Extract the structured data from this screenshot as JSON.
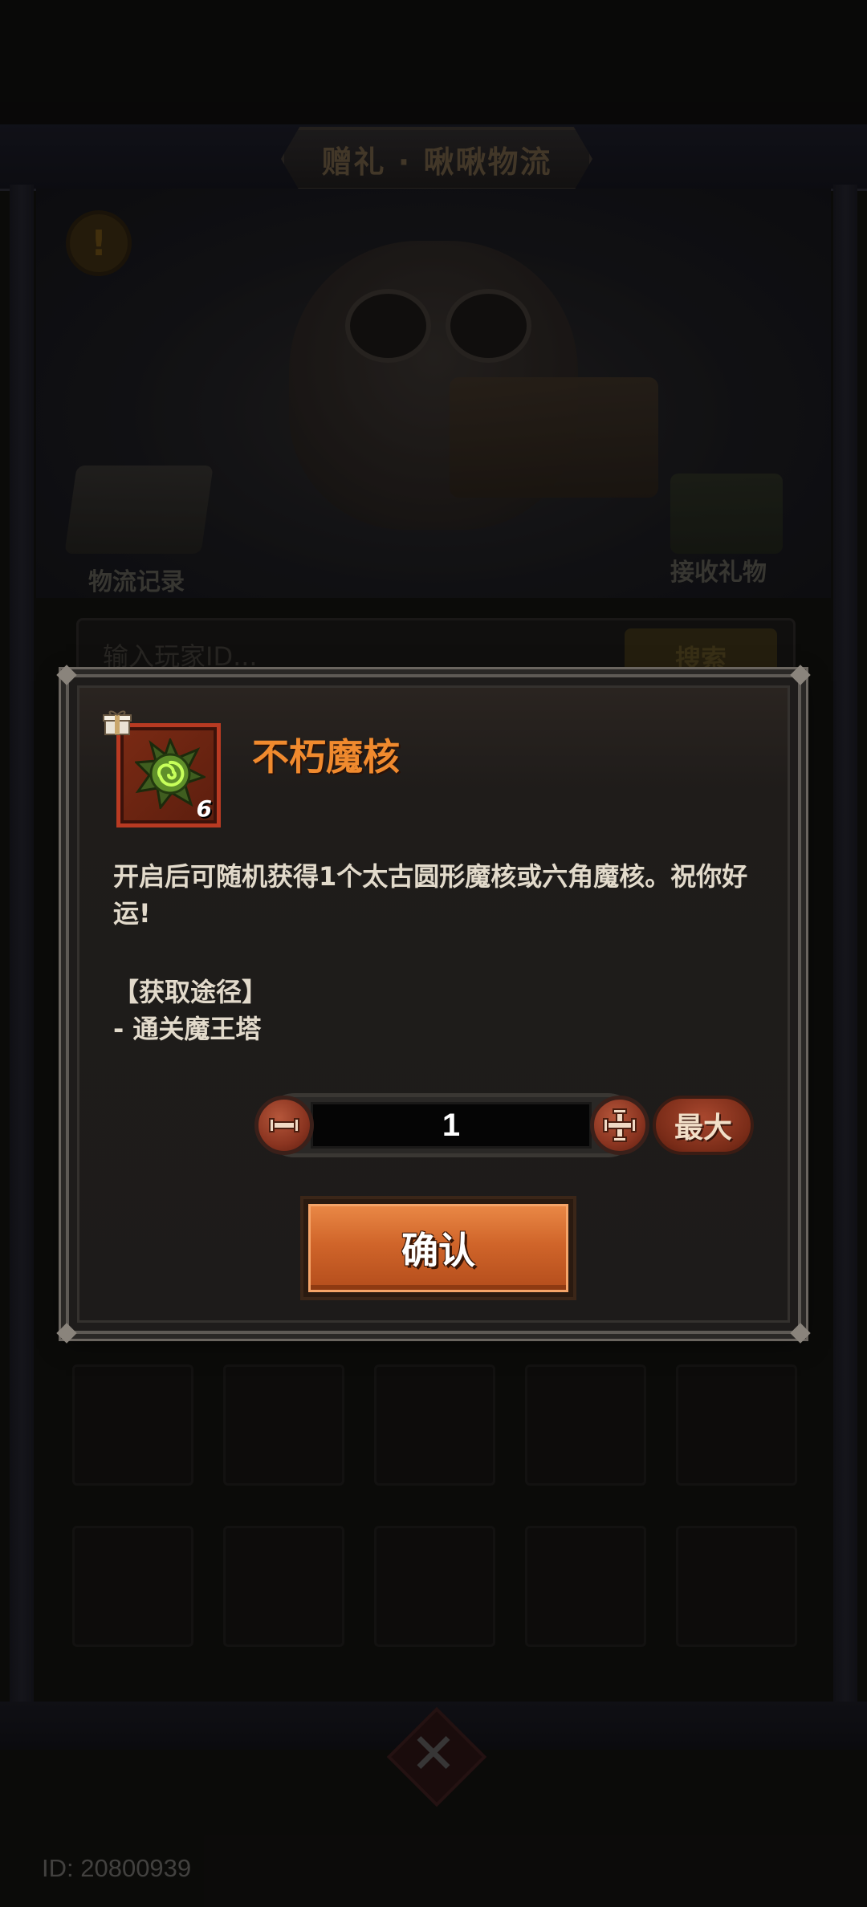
{
  "header": {
    "title": "赠礼 · 啾啾物流"
  },
  "scene": {
    "alert_icon": "!",
    "logistics_label": "物流记录",
    "receive_label": "接收礼物",
    "search_placeholder": "输入玩家ID...",
    "search_button": "搜索"
  },
  "dialog": {
    "item_name": "不朽魔核",
    "item_count": "6",
    "description": "开启后可随机获得1个太古圆形魔核或六角魔核。祝你好运!",
    "source_title": "【获取途径】",
    "source_item": "- 通关魔王塔",
    "quantity": "1",
    "max_label": "最大",
    "confirm_label": "确认",
    "colors": {
      "title": "#f08a2e",
      "confirm": "#d0652a",
      "frame": "#b83a22"
    },
    "icons": [
      "gift-icon",
      "magic-core-icon",
      "minus-icon",
      "plus-icon"
    ]
  },
  "footer": {
    "player_id": "ID: 20800939"
  }
}
